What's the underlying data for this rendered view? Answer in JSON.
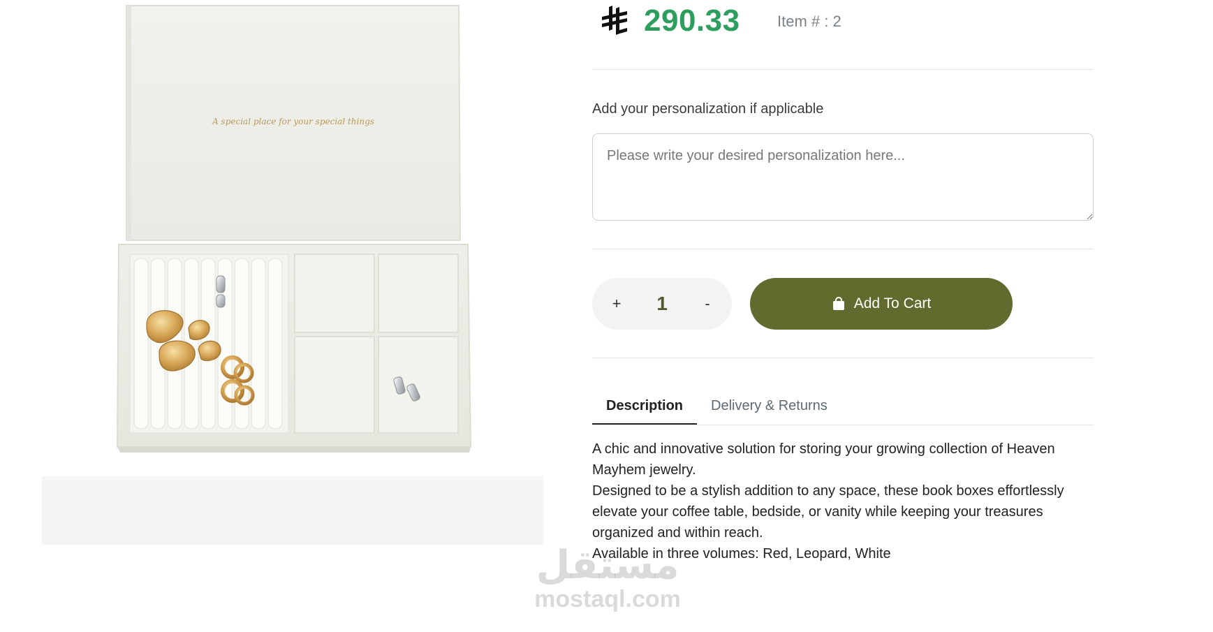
{
  "product": {
    "price": "290.33",
    "currency_icon": "saudi-riyal-icon",
    "item_number": "Item # : 2"
  },
  "personalization": {
    "label": "Add your personalization if applicable",
    "placeholder": "Please write your desired personalization here...",
    "value": ""
  },
  "cart": {
    "increment_label": "+",
    "quantity": "1",
    "decrement_label": "-",
    "add_to_cart_label": "Add To Cart",
    "add_to_cart_icon": "shopping-bag-icon",
    "button_color": "#626a2e"
  },
  "tabs": [
    {
      "label": "Description",
      "active": true
    },
    {
      "label": "Delivery & Returns",
      "active": false
    }
  ],
  "description": {
    "lines": [
      "A chic and innovative solution for storing your growing collection of Heaven Mayhem jewelry.",
      "Designed to be a stylish addition to any space, these book boxes effortlessly elevate your coffee table, bedside, or vanity while keeping your treasures organized and within reach.",
      "Available in three volumes: Red, Leopard, White"
    ]
  },
  "product_image": {
    "lid_inscription": "A special place for your special things"
  },
  "watermark": {
    "arabic": "مستقل",
    "latin": "mostaql.com"
  },
  "colors": {
    "price": "#2e9e5e",
    "accent": "#626a2e"
  }
}
